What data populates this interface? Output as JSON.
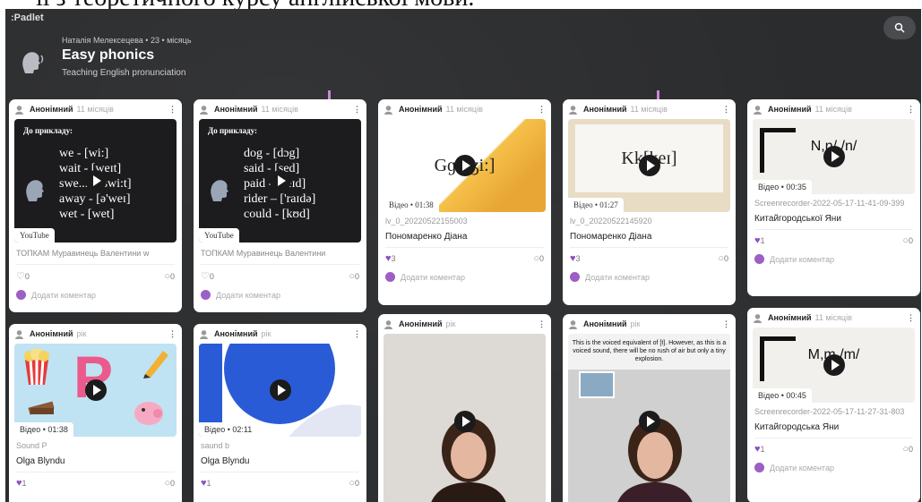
{
  "doc_text": "її з теоретичного курсу англійської мови.",
  "app": {
    "logo": ":Padlet"
  },
  "board": {
    "meta": "Наталія Мелексецева • 23 • місяць",
    "title": "Easy phonics",
    "subtitle": "Teaching English pronunciation"
  },
  "colors": {
    "board_bg": "#2b2c2e",
    "accent": "#9b5fc5",
    "heart": "#8e4ec6"
  },
  "cards": [
    {
      "author": "Анонімний",
      "time": "11 місяців",
      "thumb_type": "blackboard",
      "bb_head": "До прикладу:",
      "bb_lines": [
        "we - [wi:]",
        "wait - [weɪt]",
        "swe... - [swi:t]",
        "away - [ə'weɪ]",
        "wet - [wet]"
      ],
      "badge": "YouTube",
      "caption": "ТОПКАМ Муравинець Валентини w",
      "likes": "0",
      "comments": "0",
      "add_comment": "Додати коментар"
    },
    {
      "author": "Анонімний",
      "time": "11 місяців",
      "thumb_type": "blackboard",
      "bb_head": "До прикладу:",
      "bb_lines": [
        "dog - [dɔg]",
        "said - [sed]",
        "paid - [peɪd]",
        "rider – ['raɪdə]",
        "could - [kʊd]"
      ],
      "badge": "YouTube",
      "caption": "ТОПКАМ Муравинець Валентини",
      "likes": "0",
      "comments": "0",
      "add_comment": "Додати коментар"
    },
    {
      "author": "Анонімний",
      "time": "11 місяців",
      "thumb_text": "Gɡ[dʒi:]",
      "badge": "Відео • 01:38",
      "filename": "lv_0_20220522155003",
      "title": "Пономаренко Діана",
      "likes": "3",
      "comments": "0",
      "add_comment": "Додати коментар"
    },
    {
      "author": "Анонімний",
      "time": "11 місяців",
      "thumb_text": "Kk[keɪ]",
      "badge": "Відео • 01:27",
      "filename": "lv_0_20220522145920",
      "title": "Пономаренко Діана",
      "likes": "3",
      "comments": "0",
      "add_comment": "Додати коментар"
    },
    {
      "author": "Анонімний",
      "time": "11 місяців",
      "thumb_text": "N,n/ /n/",
      "badge": "Відео • 00:35",
      "filename": "Screenrecorder-2022-05-17-11-41-09-399",
      "title": "Китайгородської Яни",
      "likes": "1",
      "comments": "0",
      "add_comment": "Додати коментар"
    },
    {
      "author": "Анонімний",
      "time": "рік",
      "badge": "Відео • 01:38",
      "filename": "Sound P",
      "title": "Olga Blyndu",
      "likes": "1",
      "comments": "0"
    },
    {
      "author": "Анонімний",
      "time": "рік",
      "badge": "Відео • 02:11",
      "filename": "saund b",
      "title": "Olga Blyndu",
      "likes": "1",
      "comments": "0"
    },
    {
      "author": "Анонімний",
      "time": "рік"
    },
    {
      "author": "Анонімний",
      "time": "рік",
      "note": "This is the voiced equivalent of [t]. However, as this is a voiced sound, there will be no rush of air but only a tiny explosion."
    },
    {
      "author": "Анонімний",
      "time": "11 місяців",
      "thumb_text": "M,m /m/",
      "badge": "Відео • 00:45",
      "filename": "Screenrecorder-2022-05-17-11-27-31-803",
      "title": "Китайгородська Яни",
      "likes": "1",
      "comments": "0",
      "add_comment": "Додати коментар"
    }
  ]
}
